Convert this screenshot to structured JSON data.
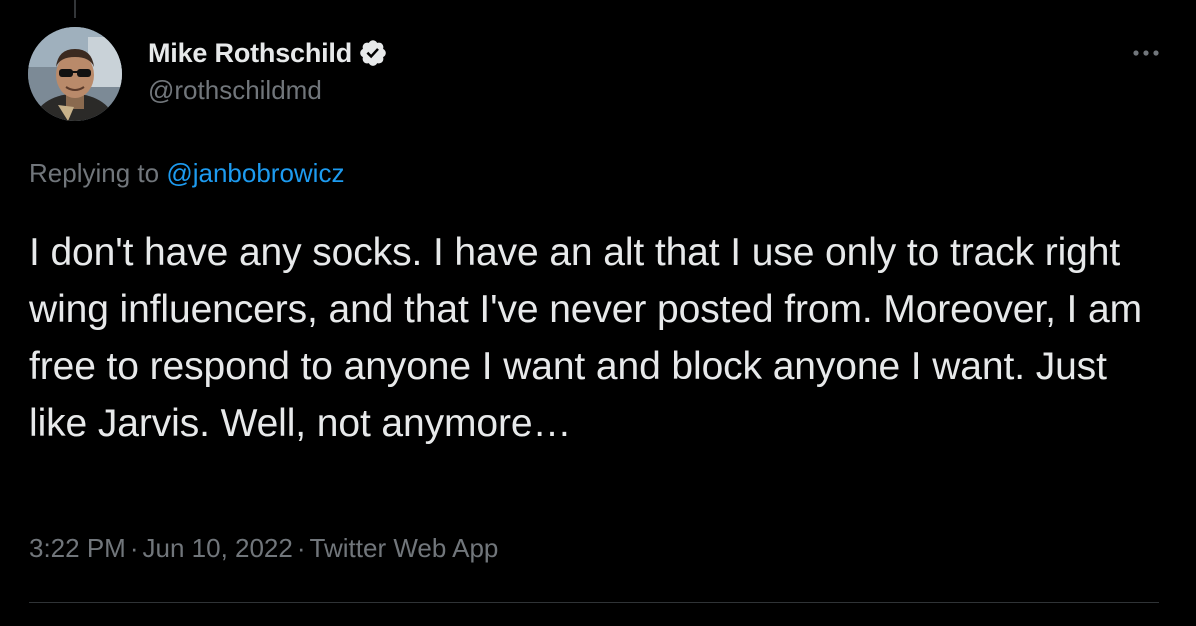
{
  "author": {
    "display_name": "Mike Rothschild",
    "handle": "@rothschildmd",
    "verified": true
  },
  "reply": {
    "prefix": "Replying to",
    "mention": "@janbobrowicz"
  },
  "tweet": {
    "text": "I don't have any socks. I have an alt that I use only to track right wing influencers, and that I've never posted from. Moreover, I am free to respond to anyone I want and block anyone I want. Just like Jarvis. Well, not anymore…"
  },
  "meta": {
    "time": "3:22 PM",
    "separator": "·",
    "date": "Jun 10, 2022",
    "source": "Twitter Web App"
  },
  "icons": {
    "verified": "verified-badge-icon",
    "more": "more-horizontal-icon"
  },
  "colors": {
    "background": "#000000",
    "primary_text": "#e7e9ea",
    "secondary_text": "#71767b",
    "link": "#1d9bf0",
    "divider": "#2f3336"
  }
}
